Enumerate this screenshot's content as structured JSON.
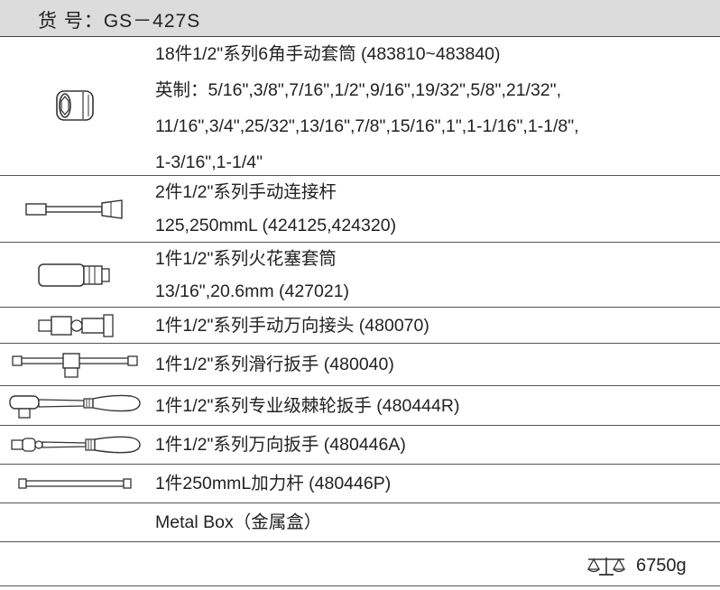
{
  "header": {
    "item_no": "货  号：GS－427S"
  },
  "items": [
    {
      "icon": "socket-icon",
      "lines": [
        "18件1/2\"系列6角手动套筒 (483810~483840)",
        "英制：5/16\",3/8\",7/16\",1/2\",9/16\",19/32\",5/8\",21/32\",",
        "11/16\",3/4\",25/32\",13/16\",7/8\",15/16\",1\",1-1/16\",1-1/8\",",
        "1-3/16\",1-1/4\""
      ]
    },
    {
      "icon": "extension-bar-icon",
      "lines": [
        "2件1/2\"系列手动连接杆",
        "125,250mmL (424125,424320)"
      ]
    },
    {
      "icon": "spark-plug-socket-icon",
      "lines": [
        "1件1/2\"系列火花塞套筒",
        "13/16\",20.6mm (427021)"
      ]
    },
    {
      "icon": "universal-joint-icon",
      "lines": [
        "1件1/2\"系列手动万向接头 (480070)"
      ]
    },
    {
      "icon": "sliding-t-bar-icon",
      "lines": [
        "1件1/2\"系列滑行扳手 (480040)"
      ]
    },
    {
      "icon": "ratchet-wrench-icon",
      "lines": [
        "1件1/2\"系列专业级棘轮扳手 (480444R)"
      ]
    },
    {
      "icon": "flex-handle-icon",
      "lines": [
        "1件1/2\"系列万向扳手 (480446A)"
      ]
    },
    {
      "icon": "breaker-bar-icon",
      "lines": [
        "1件250mmL加力杆 (480446P)"
      ]
    },
    {
      "icon": "",
      "lines": [
        "Metal Box（金属盒）"
      ]
    }
  ],
  "footer": {
    "weight_icon": "scale-icon",
    "weight": "6750g"
  }
}
